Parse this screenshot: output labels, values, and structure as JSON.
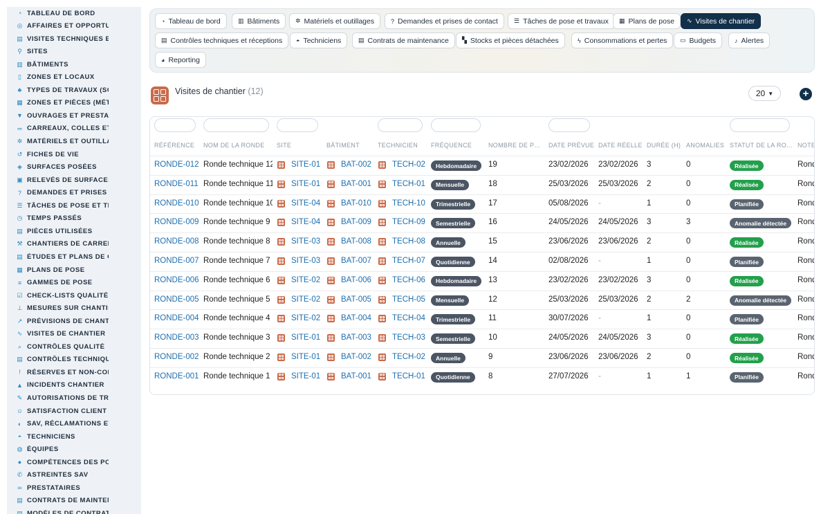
{
  "sidebar": {
    "items": [
      {
        "label": "TABLEAU DE BORD",
        "icon": "dashboard-icon",
        "glyph": "◔"
      },
      {
        "label": "AFFAIRES ET OPPORTUNITÉS",
        "icon": "target-icon",
        "glyph": "◎"
      },
      {
        "label": "VISITES TECHNIQUES ET RELEVÉS",
        "icon": "clipboard-icon",
        "glyph": "▤"
      },
      {
        "label": "SITES",
        "icon": "location-pin-icon",
        "glyph": "⚲"
      },
      {
        "label": "BÂTIMENTS",
        "icon": "building-icon",
        "glyph": "▥"
      },
      {
        "label": "ZONES ET LOCAUX",
        "icon": "door-icon",
        "glyph": "▯"
      },
      {
        "label": "TYPES DE TRAVAUX (SOLS, MURS)",
        "icon": "hierarchy-icon",
        "glyph": "♣"
      },
      {
        "label": "ZONES ET PIÈCES (MÉTRÉS)",
        "icon": "grid-icon",
        "glyph": "▦"
      },
      {
        "label": "OUVRAGES ET PRESTATIONS",
        "icon": "funnel-icon",
        "glyph": "▼"
      },
      {
        "label": "CARREAUX, COLLES ET JOINTS",
        "icon": "lines-icon",
        "glyph": "═"
      },
      {
        "label": "MATÉRIELS ET OUTILLAGES",
        "icon": "gears-icon",
        "glyph": "✲"
      },
      {
        "label": "FICHES DE VIE",
        "icon": "history-icon",
        "glyph": "↺"
      },
      {
        "label": "SURFACES POSÉES",
        "icon": "layers-icon",
        "glyph": "◈"
      },
      {
        "label": "RELEVÉS DE SURFACES",
        "icon": "ruler-icon",
        "glyph": "▣"
      },
      {
        "label": "DEMANDES ET PRISES DE CONTACT",
        "icon": "question-icon",
        "glyph": "?"
      },
      {
        "label": "TÂCHES DE POSE ET TRAVAUX",
        "icon": "tasks-icon",
        "glyph": "☰"
      },
      {
        "label": "TEMPS PASSÉS",
        "icon": "clock-icon",
        "glyph": "◷"
      },
      {
        "label": "PIÈCES UTILISÉES",
        "icon": "document-icon",
        "glyph": "▤"
      },
      {
        "label": "CHANTIERS DE CARRELAGE",
        "icon": "hammer-icon",
        "glyph": "⚒"
      },
      {
        "label": "ÉTUDES ET PLANS DE CALEPINAGE",
        "icon": "document-icon",
        "glyph": "▤"
      },
      {
        "label": "PLANS DE POSE",
        "icon": "blueprint-icon",
        "glyph": "▦"
      },
      {
        "label": "GAMMES DE POSE",
        "icon": "list-icon",
        "glyph": "≡"
      },
      {
        "label": "CHECK-LISTS QUALITÉ",
        "icon": "checklist-icon",
        "glyph": "☑"
      },
      {
        "label": "MESURES SUR CHANTIER",
        "icon": "thermometer-icon",
        "glyph": "⊥"
      },
      {
        "label": "PRÉVISIONS DE CHANTIER",
        "icon": "chart-icon",
        "glyph": "↗"
      },
      {
        "label": "VISITES DE CHANTIER",
        "icon": "route-icon",
        "glyph": "∿"
      },
      {
        "label": "CONTRÔLES QUALITÉ",
        "icon": "magnifier-icon",
        "glyph": "⌕"
      },
      {
        "label": "CONTRÔLES TECHNIQUES ET RÉCEPTIONS",
        "icon": "clipboard-check-icon",
        "glyph": "▤"
      },
      {
        "label": "RÉSERVES ET NON-CONFORMITÉS",
        "icon": "warning-icon",
        "glyph": "!"
      },
      {
        "label": "INCIDENTS CHANTIER",
        "icon": "alert-icon",
        "glyph": "▲"
      },
      {
        "label": "AUTORISATIONS DE TRAVAUX",
        "icon": "pen-icon",
        "glyph": "✎"
      },
      {
        "label": "SATISFACTION CLIENT",
        "icon": "smile-icon",
        "glyph": "☺"
      },
      {
        "label": "SAV, RÉCLAMATIONS ET GARANTIES",
        "icon": "headset-icon",
        "glyph": "◐"
      },
      {
        "label": "TECHNICIENS",
        "icon": "helmet-icon",
        "glyph": "◓"
      },
      {
        "label": "ÉQUIPES",
        "icon": "globe-icon",
        "glyph": "◍"
      },
      {
        "label": "COMPÉTENCES DES POSEURS",
        "icon": "badge-icon",
        "glyph": "●"
      },
      {
        "label": "ASTREINTES SAV",
        "icon": "phone-icon",
        "glyph": "✆"
      },
      {
        "label": "PRESTATAIRES",
        "icon": "handshake-icon",
        "glyph": "∞"
      },
      {
        "label": "CONTRATS DE MAINTENANCE",
        "icon": "contract-icon",
        "glyph": "▤"
      },
      {
        "label": "MODÈLES DE CONTRATS",
        "icon": "template-icon",
        "glyph": "▤"
      }
    ]
  },
  "nav": {
    "buttons": [
      {
        "label": "Tableau de bord",
        "icon": "dashboard-icon",
        "glyph": "◔"
      },
      {
        "label": "Bâtiments",
        "icon": "building-icon",
        "glyph": "▥"
      },
      {
        "label": "Matériels et outillages",
        "icon": "gears-icon",
        "glyph": "✲"
      },
      {
        "label": "Demandes et prises de contact",
        "icon": "question-icon",
        "glyph": "?"
      },
      {
        "label": "Tâches de pose et travaux",
        "icon": "tasks-icon",
        "glyph": "☰"
      },
      {
        "label": "Plans de pose",
        "icon": "blueprint-icon",
        "glyph": "▦"
      },
      {
        "label": "Visites de chantier",
        "icon": "route-icon",
        "glyph": "∿"
      },
      {
        "label": "Contrôles techniques et réceptions",
        "icon": "clipboard-check-icon",
        "glyph": "▤"
      },
      {
        "label": "Techniciens",
        "icon": "helmet-icon",
        "glyph": "◓"
      },
      {
        "label": "Contrats de maintenance",
        "icon": "contract-icon",
        "glyph": "▤"
      },
      {
        "label": "Stocks et pièces détachées",
        "icon": "boxes-icon",
        "glyph": "▚"
      },
      {
        "label": "Consommations et pertes",
        "icon": "bolt-icon",
        "glyph": "ϟ"
      },
      {
        "label": "Budgets",
        "icon": "money-icon",
        "glyph": "▭"
      },
      {
        "label": "Alertes",
        "icon": "bell-icon",
        "glyph": "♪"
      },
      {
        "label": "Reporting",
        "icon": "pie-icon",
        "glyph": "◕"
      }
    ]
  },
  "list": {
    "title": "Visites de chantier",
    "count": "(12)",
    "page_size": "20",
    "add_symbol": "+"
  },
  "table": {
    "columns": [
      "RÉFÉRENCE",
      "NOM DE LA RONDE",
      "SITE",
      "BÂTIMENT",
      "TECHNICIEN",
      "FRÉQUENCE",
      "NOMBRE DE P…",
      "DATE PRÉVUE",
      "DATE RÉELLE",
      "DURÉE (H)",
      "ANOMALIES",
      "STATUT DE LA RO…",
      "NOTES"
    ],
    "status_colors": {
      "Réalisée": "#22a04b",
      "Planifiée": "#5a6470",
      "Anomalie détectée": "#5a6470"
    },
    "rows": [
      {
        "ref": "RONDE-012",
        "name": "Ronde technique 12",
        "site": "SITE-01",
        "bat": "BAT-002",
        "tech": "TECH-02",
        "freq": "Hebdomadaire",
        "nb": "19",
        "prevue": "23/02/2026",
        "reelle": "23/02/2026",
        "duree": "3",
        "anom": "0",
        "statut": "Réalisée",
        "notes": "Ronde"
      },
      {
        "ref": "RONDE-011",
        "name": "Ronde technique 11",
        "site": "SITE-01",
        "bat": "BAT-001",
        "tech": "TECH-01",
        "freq": "Mensuelle",
        "nb": "18",
        "prevue": "25/03/2026",
        "reelle": "25/03/2026",
        "duree": "2",
        "anom": "0",
        "statut": "Réalisée",
        "notes": "Ronde"
      },
      {
        "ref": "RONDE-010",
        "name": "Ronde technique 10",
        "site": "SITE-04",
        "bat": "BAT-010",
        "tech": "TECH-10",
        "freq": "Trimestrielle",
        "nb": "17",
        "prevue": "05/08/2026",
        "reelle": "-",
        "duree": "1",
        "anom": "0",
        "statut": "Planifiée",
        "notes": "Ronde"
      },
      {
        "ref": "RONDE-009",
        "name": "Ronde technique 9",
        "site": "SITE-04",
        "bat": "BAT-009",
        "tech": "TECH-09",
        "freq": "Semestrielle",
        "nb": "16",
        "prevue": "24/05/2026",
        "reelle": "24/05/2026",
        "duree": "3",
        "anom": "3",
        "statut": "Anomalie détectée",
        "notes": "Ronde"
      },
      {
        "ref": "RONDE-008",
        "name": "Ronde technique 8",
        "site": "SITE-03",
        "bat": "BAT-008",
        "tech": "TECH-08",
        "freq": "Annuelle",
        "nb": "15",
        "prevue": "23/06/2026",
        "reelle": "23/06/2026",
        "duree": "2",
        "anom": "0",
        "statut": "Réalisée",
        "notes": "Ronde"
      },
      {
        "ref": "RONDE-007",
        "name": "Ronde technique 7",
        "site": "SITE-03",
        "bat": "BAT-007",
        "tech": "TECH-07",
        "freq": "Quotidienne",
        "nb": "14",
        "prevue": "02/08/2026",
        "reelle": "-",
        "duree": "1",
        "anom": "0",
        "statut": "Planifiée",
        "notes": "Ronde"
      },
      {
        "ref": "RONDE-006",
        "name": "Ronde technique 6",
        "site": "SITE-02",
        "bat": "BAT-006",
        "tech": "TECH-06",
        "freq": "Hebdomadaire",
        "nb": "13",
        "prevue": "23/02/2026",
        "reelle": "23/02/2026",
        "duree": "3",
        "anom": "0",
        "statut": "Réalisée",
        "notes": "Ronde"
      },
      {
        "ref": "RONDE-005",
        "name": "Ronde technique 5",
        "site": "SITE-02",
        "bat": "BAT-005",
        "tech": "TECH-05",
        "freq": "Mensuelle",
        "nb": "12",
        "prevue": "25/03/2026",
        "reelle": "25/03/2026",
        "duree": "2",
        "anom": "2",
        "statut": "Anomalie détectée",
        "notes": "Ronde"
      },
      {
        "ref": "RONDE-004",
        "name": "Ronde technique 4",
        "site": "SITE-02",
        "bat": "BAT-004",
        "tech": "TECH-04",
        "freq": "Trimestrielle",
        "nb": "11",
        "prevue": "30/07/2026",
        "reelle": "-",
        "duree": "1",
        "anom": "0",
        "statut": "Planifiée",
        "notes": "Ronde"
      },
      {
        "ref": "RONDE-003",
        "name": "Ronde technique 3",
        "site": "SITE-01",
        "bat": "BAT-003",
        "tech": "TECH-03",
        "freq": "Semestrielle",
        "nb": "10",
        "prevue": "24/05/2026",
        "reelle": "24/05/2026",
        "duree": "3",
        "anom": "0",
        "statut": "Réalisée",
        "notes": "Ronde"
      },
      {
        "ref": "RONDE-002",
        "name": "Ronde technique 2",
        "site": "SITE-01",
        "bat": "BAT-002",
        "tech": "TECH-02",
        "freq": "Annuelle",
        "nb": "9",
        "prevue": "23/06/2026",
        "reelle": "23/06/2026",
        "duree": "2",
        "anom": "0",
        "statut": "Réalisée",
        "notes": "Ronde"
      },
      {
        "ref": "RONDE-001",
        "name": "Ronde technique 1",
        "site": "SITE-01",
        "bat": "BAT-001",
        "tech": "TECH-01",
        "freq": "Quotidienne",
        "nb": "8",
        "prevue": "27/07/2026",
        "reelle": "-",
        "duree": "1",
        "anom": "1",
        "statut": "Planifiée",
        "notes": "Ronde"
      }
    ]
  }
}
